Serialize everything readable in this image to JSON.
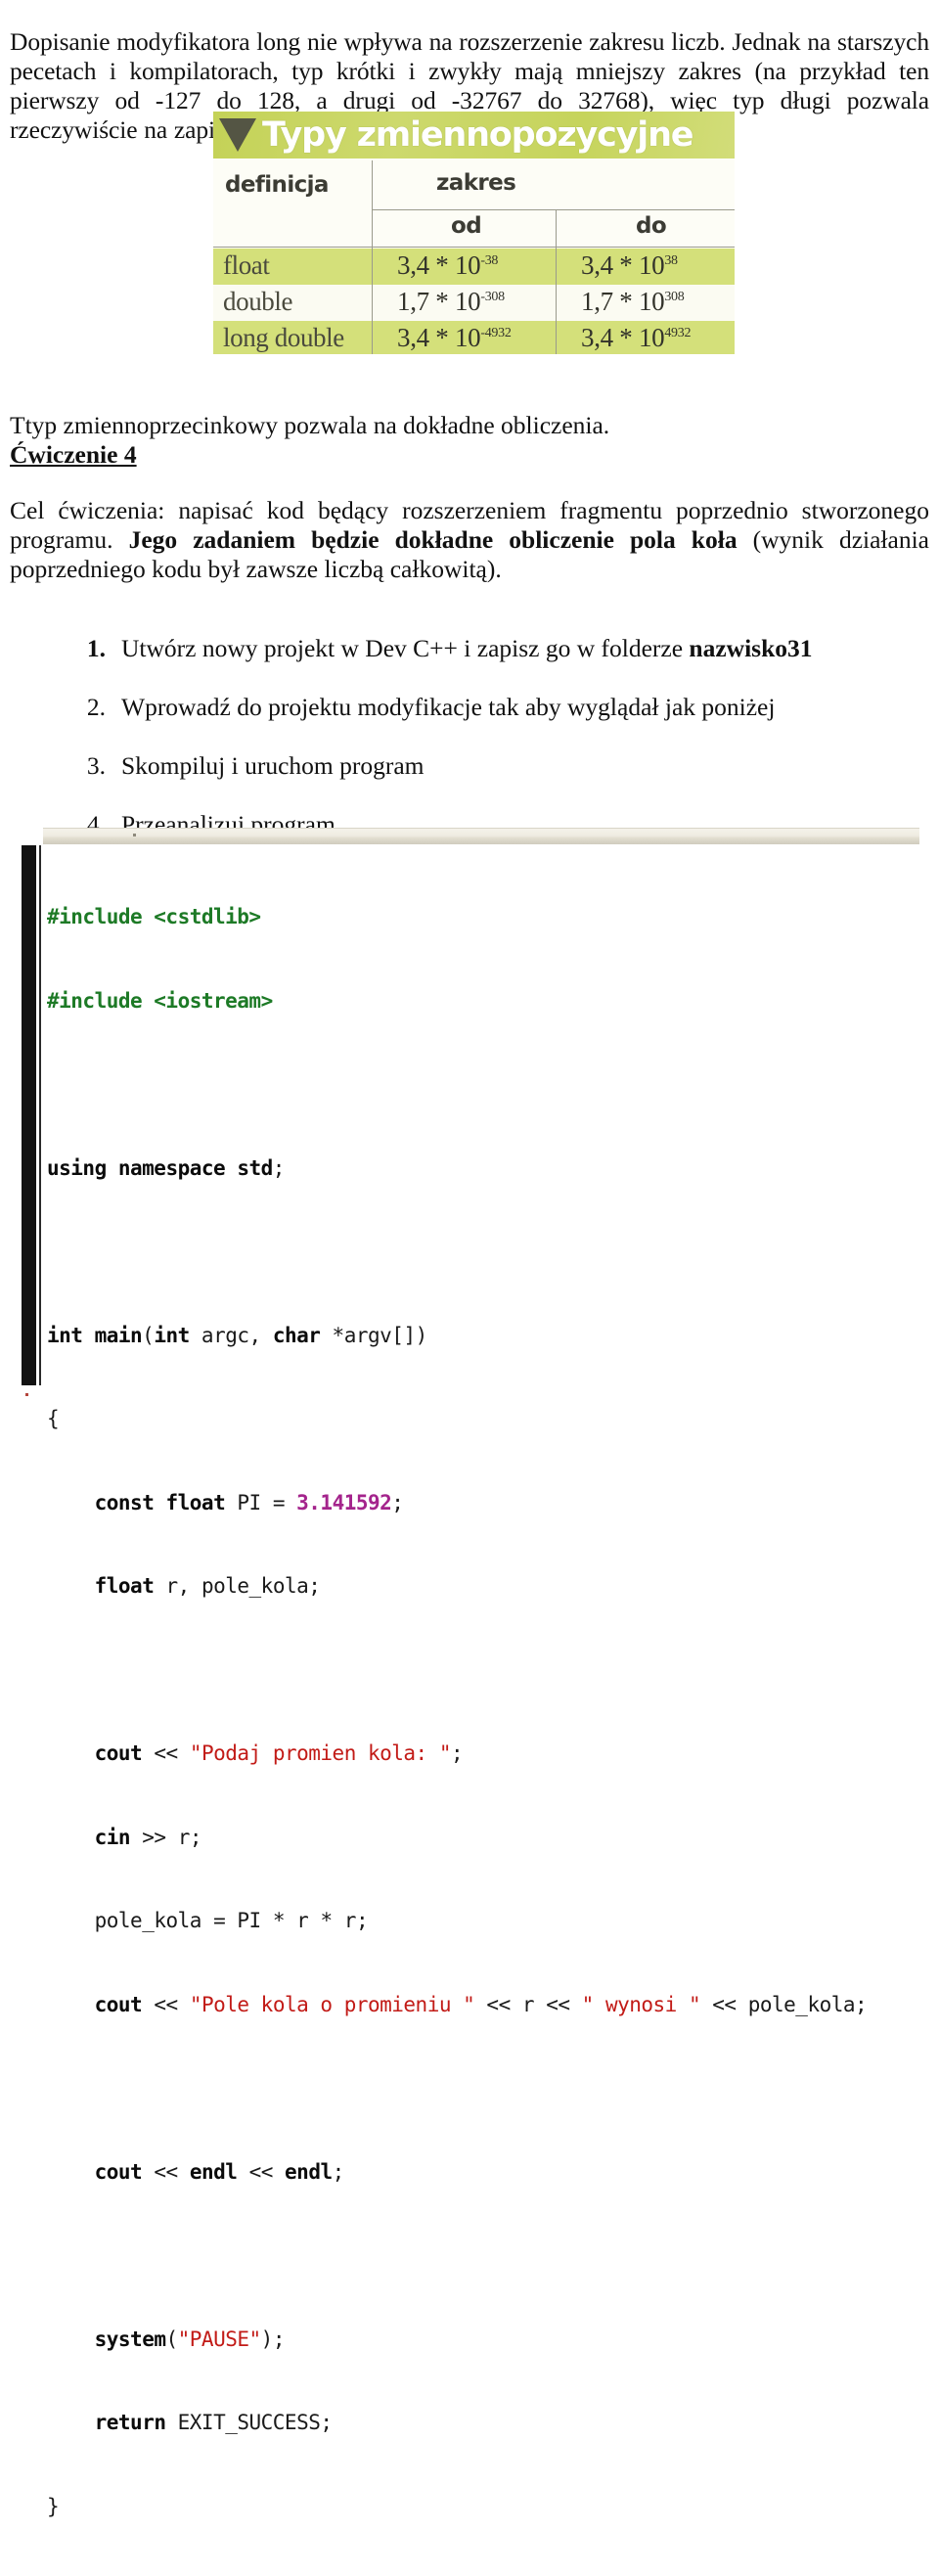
{
  "document": {
    "intro_paragraph": "Dopisanie modyfikatora long nie wpływa na rozszerzenie zakresu liczb. Jednak na starszych pecetach i kompilatorach, typ krótki i zwykły mają mniejszy zakres (na przykład ten pierwszy od -127 do 128, a drugi od -32767 do 32768), więc typ długi pozwala rzeczywiście na zapisanie większej liczby",
    "after_table_paragraph": "Ttyp zmiennoprzecinkowy pozwala na dokładne obliczenia.",
    "exercise_heading": "Ćwiczenie 4",
    "exercise_body_1": "Cel ćwiczenia: napisać kod będący rozszerzeniem fragmentu poprzednio stworzonego programu. ",
    "exercise_body_bold": "Jego zadaniem będzie dokładne obliczenie pola koła",
    "exercise_body_2": " (wynik działania poprzedniego kodu był zawsze liczbą całkowitą)."
  },
  "figure": {
    "title": "Typy zmiennopozycyjne",
    "triangle_icon": "triangle-down-icon",
    "accent_color": "#c9d65e",
    "row_highlight_color": "#d4e07a",
    "headers": {
      "definicja": "definicja",
      "zakres": "zakres",
      "od": "od",
      "do": "do"
    },
    "rows": [
      {
        "definicja": "float",
        "od_mantissa": "3,4 * 10",
        "od_exp": "-38",
        "do_mantissa": "3,4 * 10",
        "do_exp": "38"
      },
      {
        "definicja": "double",
        "od_mantissa": "1,7 * 10",
        "od_exp": "-308",
        "do_mantissa": "1,7 * 10",
        "do_exp": "308"
      },
      {
        "definicja": "long double",
        "od_mantissa": "3,4 * 10",
        "od_exp": "-4932",
        "do_mantissa": "3,4 * 10",
        "do_exp": "4932"
      }
    ]
  },
  "steps": [
    {
      "num": "1.",
      "text_before": "Utwórz nowy projekt w Dev C++ i zapisz go w folderze ",
      "text_bold": "nazwisko31",
      "text_after": ""
    },
    {
      "num": "2.",
      "text_before": "Wprowadź do projektu modyfikacje tak aby wyglądał jak poniżej",
      "text_bold": "",
      "text_after": ""
    },
    {
      "num": "3.",
      "text_before": "Skompiluj i uruchom program",
      "text_bold": "",
      "text_after": ""
    },
    {
      "num": "4.",
      "text_before": "Przeanalizuj program",
      "text_bold": "",
      "text_after": ""
    }
  ],
  "code": {
    "language": "cpp",
    "colors": {
      "preprocessor": "#1d7a26",
      "string": "#c21b17",
      "number": "#a4248c",
      "keyword": "#0b0b0b"
    },
    "lines": [
      "#include <cstdlib>",
      "#include <iostream>",
      "",
      "using namespace std;",
      "",
      "int main(int argc, char *argv[])",
      "{",
      "    const float PI = 3.141592;",
      "    float r, pole_kola;",
      "",
      "    cout << \"Podaj promien kola: \";",
      "    cin >> r;",
      "    pole_kola = PI * r * r;",
      "    cout << \"Pole kola o promieniu \" << r << \" wynosi \" << pole_kola;",
      "",
      "    cout << endl << endl;",
      "",
      "    system(\"PAUSE\");",
      "    return EXIT_SUCCESS;",
      "}"
    ]
  }
}
